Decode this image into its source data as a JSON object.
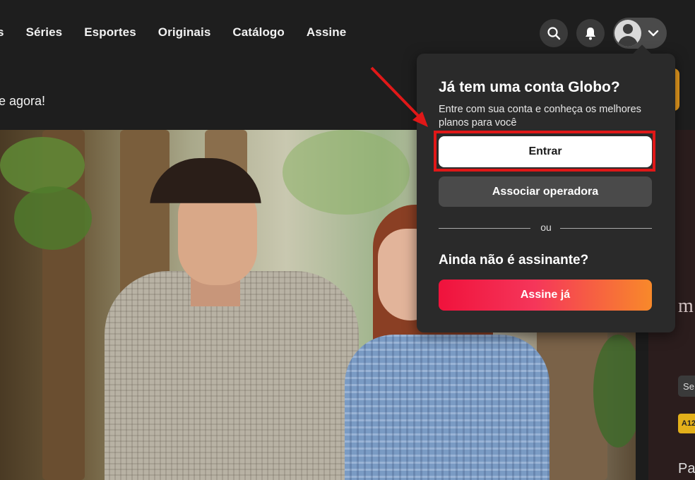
{
  "nav": {
    "items": [
      "s",
      "Séries",
      "Esportes",
      "Originais",
      "Catálogo",
      "Assine"
    ]
  },
  "header": {
    "search_icon": "search-icon",
    "bell_icon": "bell-icon",
    "avatar_icon": "user-avatar-icon",
    "chevron_icon": "chevron-down-icon"
  },
  "promo": {
    "text": "e agora!"
  },
  "account_menu": {
    "title": "Já tem uma conta Globo?",
    "subtitle": "Entre com sua conta e conheça os melhores planos para você",
    "login_button": "Entrar",
    "operator_button": "Associar operadora",
    "or_label": "ou",
    "subscribe_title": "Ainda não é assinante?",
    "subscribe_button": "Assine já"
  },
  "side_panel": {
    "title_fragment": "m",
    "badge_se": "Se",
    "rating_badge": "A12",
    "text_fragment": "Pa"
  },
  "colors": {
    "accent_red": "#f0123c",
    "accent_orange": "#f8892a",
    "annotation_red": "#e01818",
    "background": "#1c1c1c"
  }
}
